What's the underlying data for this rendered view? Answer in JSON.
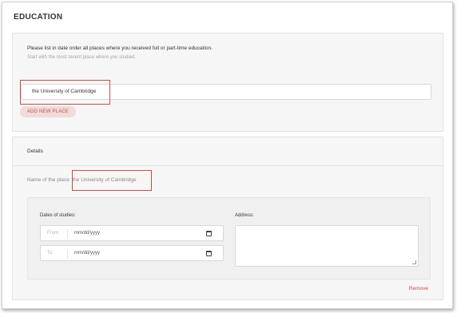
{
  "page": {
    "title": "EDUCATION"
  },
  "places": {
    "instruction": "Please list in date order all places where you received full or part-time education.",
    "instruction_sub": "Start with the most recent place where you studied.",
    "place_input_value": "the University of Cambridge",
    "add_button_label": "ADD NEW PLACE"
  },
  "details": {
    "title": "Details",
    "name_label": "Name of the place:",
    "name_value": "the University of Cambridge",
    "dates_label": "Dates of studies:",
    "from_label": "From:",
    "from_placeholder": "mm/dd/yyyy",
    "to_label": "To:",
    "to_placeholder": "mm/dd/yyyy",
    "address_label": "Address:",
    "address_value": "",
    "remove_label": "Remove"
  },
  "colors": {
    "accent": "#c0504d",
    "add_button_bg": "#f1dada",
    "panel_bg": "#f6f6f6"
  },
  "icons": {
    "calendar": "calendar-icon"
  }
}
